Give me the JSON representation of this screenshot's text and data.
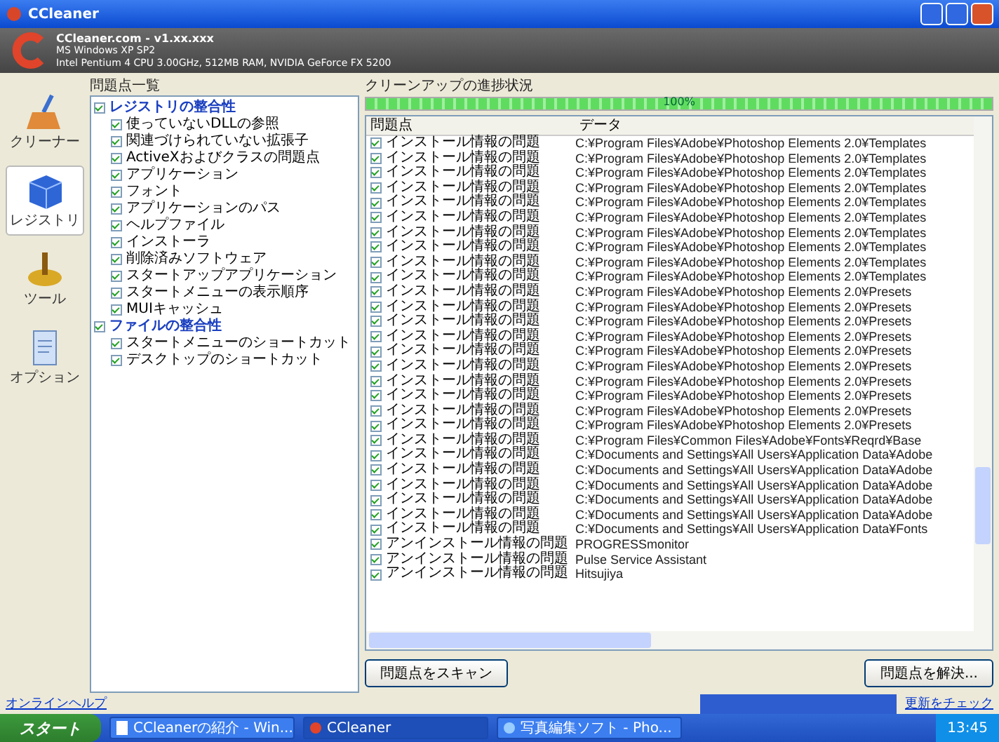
{
  "window": {
    "title": "CCleaner"
  },
  "header": {
    "product": "CCleaner.com - v1.xx.xxx",
    "os": "MS Windows XP SP2",
    "hardware": "Intel Pentium 4 CPU 3.00GHz, 512MB RAM, NVIDIA GeForce FX 5200"
  },
  "sidebar": {
    "items": [
      {
        "label": "クリーナー",
        "kind": "broom",
        "selected": false
      },
      {
        "label": "レジストリ",
        "kind": "cube",
        "selected": true
      },
      {
        "label": "ツール",
        "kind": "tool",
        "selected": false
      },
      {
        "label": "オプション",
        "kind": "doc",
        "selected": false
      }
    ]
  },
  "tree": {
    "title": "問題点一覧",
    "groups": [
      {
        "label": "レジストリの整合性",
        "checked": true,
        "children": [
          {
            "label": "使っていないDLLの参照",
            "checked": true
          },
          {
            "label": "関連づけられていない拡張子",
            "checked": true
          },
          {
            "label": "ActiveXおよびクラスの問題点",
            "checked": true
          },
          {
            "label": "アプリケーション",
            "checked": true
          },
          {
            "label": "フォント",
            "checked": true
          },
          {
            "label": "アプリケーションのパス",
            "checked": true
          },
          {
            "label": "ヘルプファイル",
            "checked": true
          },
          {
            "label": "インストーラ",
            "checked": true
          },
          {
            "label": "削除済みソフトウェア",
            "checked": true
          },
          {
            "label": "スタートアップアプリケーション",
            "checked": true
          },
          {
            "label": "スタートメニューの表示順序",
            "checked": true
          },
          {
            "label": "MUIキャッシュ",
            "checked": true
          }
        ]
      },
      {
        "label": "ファイルの整合性",
        "checked": true,
        "children": [
          {
            "label": "スタートメニューのショートカット",
            "checked": true
          },
          {
            "label": "デスクトップのショートカット",
            "checked": true
          }
        ]
      }
    ]
  },
  "progress": {
    "label": "クリーンアップの進捗状況",
    "level": 1,
    "reading": "100%"
  },
  "table": {
    "columns": [
      "問題点",
      "データ"
    ],
    "rows": [
      {
        "checked": true,
        "problem": "インストール情報の問題",
        "data": "C:¥Program Files¥Adobe¥Photoshop Elements 2.0¥Templates"
      },
      {
        "checked": true,
        "problem": "インストール情報の問題",
        "data": "C:¥Program Files¥Adobe¥Photoshop Elements 2.0¥Templates"
      },
      {
        "checked": true,
        "problem": "インストール情報の問題",
        "data": "C:¥Program Files¥Adobe¥Photoshop Elements 2.0¥Templates"
      },
      {
        "checked": true,
        "problem": "インストール情報の問題",
        "data": "C:¥Program Files¥Adobe¥Photoshop Elements 2.0¥Templates"
      },
      {
        "checked": true,
        "problem": "インストール情報の問題",
        "data": "C:¥Program Files¥Adobe¥Photoshop Elements 2.0¥Templates"
      },
      {
        "checked": true,
        "problem": "インストール情報の問題",
        "data": "C:¥Program Files¥Adobe¥Photoshop Elements 2.0¥Templates"
      },
      {
        "checked": true,
        "problem": "インストール情報の問題",
        "data": "C:¥Program Files¥Adobe¥Photoshop Elements 2.0¥Templates"
      },
      {
        "checked": true,
        "problem": "インストール情報の問題",
        "data": "C:¥Program Files¥Adobe¥Photoshop Elements 2.0¥Templates"
      },
      {
        "checked": true,
        "problem": "インストール情報の問題",
        "data": "C:¥Program Files¥Adobe¥Photoshop Elements 2.0¥Templates"
      },
      {
        "checked": true,
        "problem": "インストール情報の問題",
        "data": "C:¥Program Files¥Adobe¥Photoshop Elements 2.0¥Templates"
      },
      {
        "checked": true,
        "problem": "インストール情報の問題",
        "data": "C:¥Program Files¥Adobe¥Photoshop Elements 2.0¥Presets"
      },
      {
        "checked": true,
        "problem": "インストール情報の問題",
        "data": "C:¥Program Files¥Adobe¥Photoshop Elements 2.0¥Presets"
      },
      {
        "checked": true,
        "problem": "インストール情報の問題",
        "data": "C:¥Program Files¥Adobe¥Photoshop Elements 2.0¥Presets"
      },
      {
        "checked": true,
        "problem": "インストール情報の問題",
        "data": "C:¥Program Files¥Adobe¥Photoshop Elements 2.0¥Presets"
      },
      {
        "checked": true,
        "problem": "インストール情報の問題",
        "data": "C:¥Program Files¥Adobe¥Photoshop Elements 2.0¥Presets"
      },
      {
        "checked": true,
        "problem": "インストール情報の問題",
        "data": "C:¥Program Files¥Adobe¥Photoshop Elements 2.0¥Presets"
      },
      {
        "checked": true,
        "problem": "インストール情報の問題",
        "data": "C:¥Program Files¥Adobe¥Photoshop Elements 2.0¥Presets"
      },
      {
        "checked": true,
        "problem": "インストール情報の問題",
        "data": "C:¥Program Files¥Adobe¥Photoshop Elements 2.0¥Presets"
      },
      {
        "checked": true,
        "problem": "インストール情報の問題",
        "data": "C:¥Program Files¥Adobe¥Photoshop Elements 2.0¥Presets"
      },
      {
        "checked": true,
        "problem": "インストール情報の問題",
        "data": "C:¥Program Files¥Adobe¥Photoshop Elements 2.0¥Presets"
      },
      {
        "checked": true,
        "problem": "インストール情報の問題",
        "data": "C:¥Program Files¥Common Files¥Adobe¥Fonts¥Reqrd¥Base"
      },
      {
        "checked": true,
        "problem": "インストール情報の問題",
        "data": "C:¥Documents and Settings¥All Users¥Application Data¥Adobe"
      },
      {
        "checked": true,
        "problem": "インストール情報の問題",
        "data": "C:¥Documents and Settings¥All Users¥Application Data¥Adobe"
      },
      {
        "checked": true,
        "problem": "インストール情報の問題",
        "data": "C:¥Documents and Settings¥All Users¥Application Data¥Adobe"
      },
      {
        "checked": true,
        "problem": "インストール情報の問題",
        "data": "C:¥Documents and Settings¥All Users¥Application Data¥Adobe"
      },
      {
        "checked": true,
        "problem": "インストール情報の問題",
        "data": "C:¥Documents and Settings¥All Users¥Application Data¥Adobe"
      },
      {
        "checked": true,
        "problem": "インストール情報の問題",
        "data": "C:¥Documents and Settings¥All Users¥Application Data¥Fonts"
      },
      {
        "checked": true,
        "problem": "アンインストール情報の問題",
        "data": "PROGRESSmonitor"
      },
      {
        "checked": true,
        "problem": "アンインストール情報の問題",
        "data": "Pulse Service Assistant"
      },
      {
        "checked": true,
        "problem": "アンインストール情報の問題",
        "data": "Hitsujiya"
      }
    ]
  },
  "buttons": [
    {
      "label": "問題点をスキャン"
    },
    {
      "label": "問題点を解決..."
    }
  ],
  "footer": {
    "help_link": "オンラインヘルプ",
    "update_link": "更新をチェック"
  },
  "taskbar": {
    "start": "スタート",
    "tasks": [
      {
        "label": "CCleanerの紹介 - Win...",
        "kind": "doc",
        "selected": false
      },
      {
        "label": "CCleaner",
        "kind": "app",
        "selected": true
      },
      {
        "label": "写真編集ソフト - Pho...",
        "kind": "browser",
        "selected": false
      }
    ],
    "clock": "13:45"
  }
}
